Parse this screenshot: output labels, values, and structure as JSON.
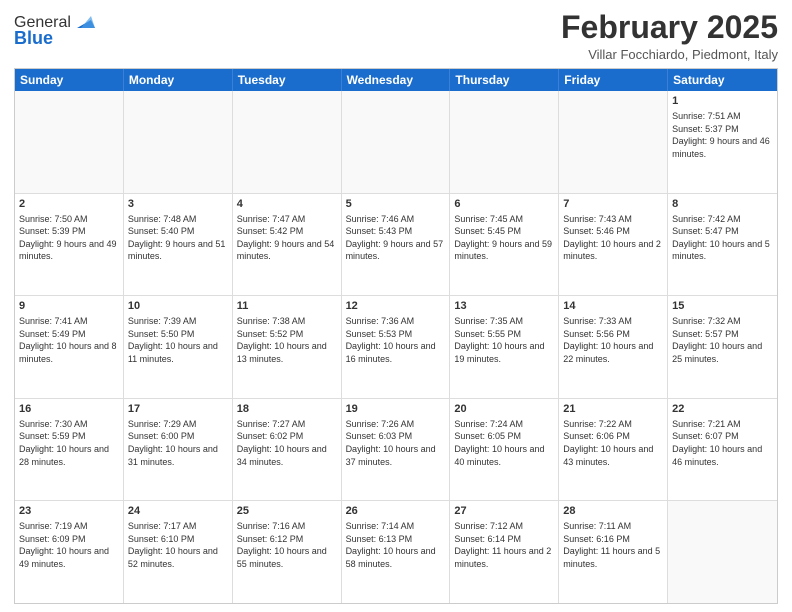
{
  "header": {
    "logo_general": "General",
    "logo_blue": "Blue",
    "month_title": "February 2025",
    "location": "Villar Focchiardo, Piedmont, Italy"
  },
  "calendar": {
    "days_of_week": [
      "Sunday",
      "Monday",
      "Tuesday",
      "Wednesday",
      "Thursday",
      "Friday",
      "Saturday"
    ],
    "weeks": [
      [
        {
          "day": "",
          "info": "",
          "empty": true
        },
        {
          "day": "",
          "info": "",
          "empty": true
        },
        {
          "day": "",
          "info": "",
          "empty": true
        },
        {
          "day": "",
          "info": "",
          "empty": true
        },
        {
          "day": "",
          "info": "",
          "empty": true
        },
        {
          "day": "",
          "info": "",
          "empty": true
        },
        {
          "day": "1",
          "info": "Sunrise: 7:51 AM\nSunset: 5:37 PM\nDaylight: 9 hours and 46 minutes.",
          "empty": false
        }
      ],
      [
        {
          "day": "2",
          "info": "Sunrise: 7:50 AM\nSunset: 5:39 PM\nDaylight: 9 hours and 49 minutes.",
          "empty": false
        },
        {
          "day": "3",
          "info": "Sunrise: 7:48 AM\nSunset: 5:40 PM\nDaylight: 9 hours and 51 minutes.",
          "empty": false
        },
        {
          "day": "4",
          "info": "Sunrise: 7:47 AM\nSunset: 5:42 PM\nDaylight: 9 hours and 54 minutes.",
          "empty": false
        },
        {
          "day": "5",
          "info": "Sunrise: 7:46 AM\nSunset: 5:43 PM\nDaylight: 9 hours and 57 minutes.",
          "empty": false
        },
        {
          "day": "6",
          "info": "Sunrise: 7:45 AM\nSunset: 5:45 PM\nDaylight: 9 hours and 59 minutes.",
          "empty": false
        },
        {
          "day": "7",
          "info": "Sunrise: 7:43 AM\nSunset: 5:46 PM\nDaylight: 10 hours and 2 minutes.",
          "empty": false
        },
        {
          "day": "8",
          "info": "Sunrise: 7:42 AM\nSunset: 5:47 PM\nDaylight: 10 hours and 5 minutes.",
          "empty": false
        }
      ],
      [
        {
          "day": "9",
          "info": "Sunrise: 7:41 AM\nSunset: 5:49 PM\nDaylight: 10 hours and 8 minutes.",
          "empty": false
        },
        {
          "day": "10",
          "info": "Sunrise: 7:39 AM\nSunset: 5:50 PM\nDaylight: 10 hours and 11 minutes.",
          "empty": false
        },
        {
          "day": "11",
          "info": "Sunrise: 7:38 AM\nSunset: 5:52 PM\nDaylight: 10 hours and 13 minutes.",
          "empty": false
        },
        {
          "day": "12",
          "info": "Sunrise: 7:36 AM\nSunset: 5:53 PM\nDaylight: 10 hours and 16 minutes.",
          "empty": false
        },
        {
          "day": "13",
          "info": "Sunrise: 7:35 AM\nSunset: 5:55 PM\nDaylight: 10 hours and 19 minutes.",
          "empty": false
        },
        {
          "day": "14",
          "info": "Sunrise: 7:33 AM\nSunset: 5:56 PM\nDaylight: 10 hours and 22 minutes.",
          "empty": false
        },
        {
          "day": "15",
          "info": "Sunrise: 7:32 AM\nSunset: 5:57 PM\nDaylight: 10 hours and 25 minutes.",
          "empty": false
        }
      ],
      [
        {
          "day": "16",
          "info": "Sunrise: 7:30 AM\nSunset: 5:59 PM\nDaylight: 10 hours and 28 minutes.",
          "empty": false
        },
        {
          "day": "17",
          "info": "Sunrise: 7:29 AM\nSunset: 6:00 PM\nDaylight: 10 hours and 31 minutes.",
          "empty": false
        },
        {
          "day": "18",
          "info": "Sunrise: 7:27 AM\nSunset: 6:02 PM\nDaylight: 10 hours and 34 minutes.",
          "empty": false
        },
        {
          "day": "19",
          "info": "Sunrise: 7:26 AM\nSunset: 6:03 PM\nDaylight: 10 hours and 37 minutes.",
          "empty": false
        },
        {
          "day": "20",
          "info": "Sunrise: 7:24 AM\nSunset: 6:05 PM\nDaylight: 10 hours and 40 minutes.",
          "empty": false
        },
        {
          "day": "21",
          "info": "Sunrise: 7:22 AM\nSunset: 6:06 PM\nDaylight: 10 hours and 43 minutes.",
          "empty": false
        },
        {
          "day": "22",
          "info": "Sunrise: 7:21 AM\nSunset: 6:07 PM\nDaylight: 10 hours and 46 minutes.",
          "empty": false
        }
      ],
      [
        {
          "day": "23",
          "info": "Sunrise: 7:19 AM\nSunset: 6:09 PM\nDaylight: 10 hours and 49 minutes.",
          "empty": false
        },
        {
          "day": "24",
          "info": "Sunrise: 7:17 AM\nSunset: 6:10 PM\nDaylight: 10 hours and 52 minutes.",
          "empty": false
        },
        {
          "day": "25",
          "info": "Sunrise: 7:16 AM\nSunset: 6:12 PM\nDaylight: 10 hours and 55 minutes.",
          "empty": false
        },
        {
          "day": "26",
          "info": "Sunrise: 7:14 AM\nSunset: 6:13 PM\nDaylight: 10 hours and 58 minutes.",
          "empty": false
        },
        {
          "day": "27",
          "info": "Sunrise: 7:12 AM\nSunset: 6:14 PM\nDaylight: 11 hours and 2 minutes.",
          "empty": false
        },
        {
          "day": "28",
          "info": "Sunrise: 7:11 AM\nSunset: 6:16 PM\nDaylight: 11 hours and 5 minutes.",
          "empty": false
        },
        {
          "day": "",
          "info": "",
          "empty": true
        }
      ]
    ]
  }
}
